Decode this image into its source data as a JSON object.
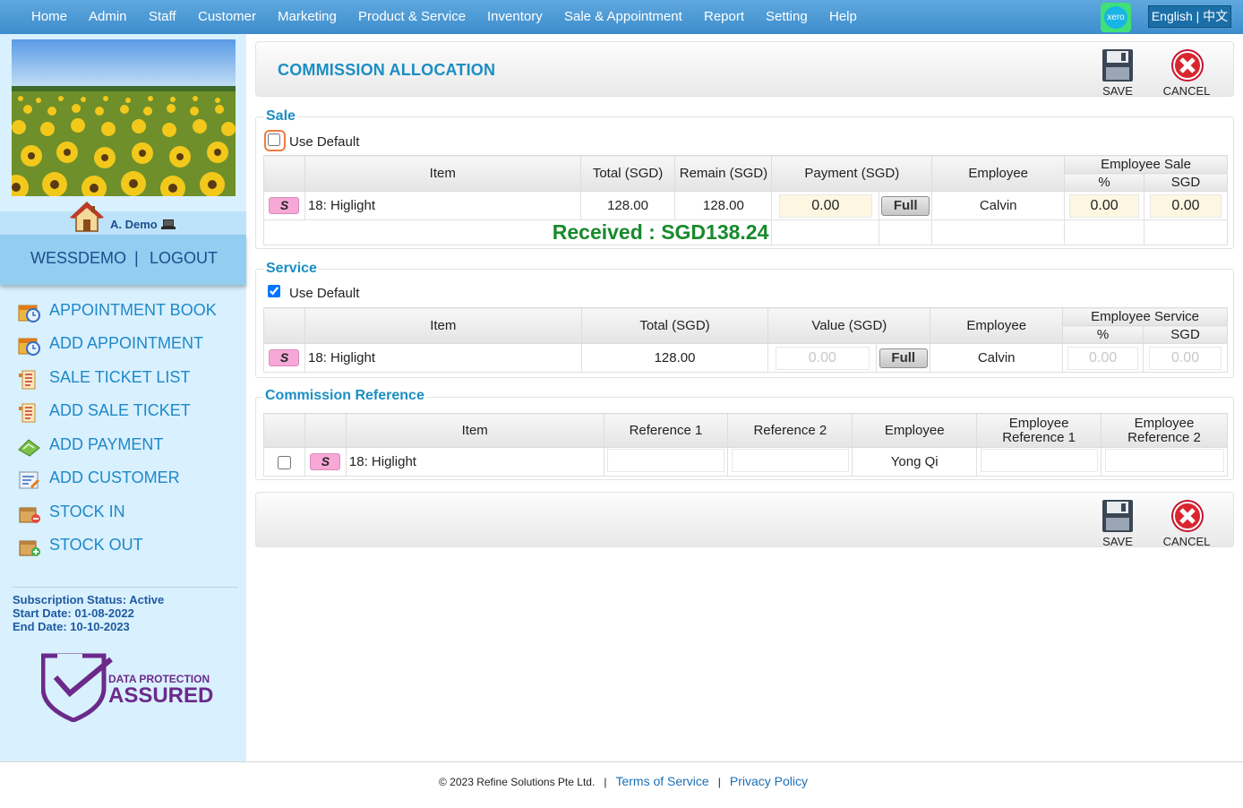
{
  "nav": {
    "items": [
      "Home",
      "Admin",
      "Staff",
      "Customer",
      "Marketing",
      "Product & Service",
      "Inventory",
      "Sale & Appointment",
      "Report",
      "Setting",
      "Help"
    ],
    "xero_label": "xero",
    "lang_english": "English",
    "lang_sep": "|",
    "lang_chinese": "中文"
  },
  "sidebar": {
    "user_name": "A. Demo",
    "company": "WESSDEMO",
    "separator": "|",
    "logout": "LOGOUT",
    "menu": [
      {
        "label": "APPOINTMENT BOOK",
        "icon": "calendar-clock-icon"
      },
      {
        "label": "ADD APPOINTMENT",
        "icon": "calendar-clock-icon"
      },
      {
        "label": "SALE TICKET LIST",
        "icon": "ticket-list-icon"
      },
      {
        "label": "ADD SALE TICKET",
        "icon": "ticket-list-icon"
      },
      {
        "label": "ADD PAYMENT",
        "icon": "payment-icon"
      },
      {
        "label": "ADD CUSTOMER",
        "icon": "add-customer-icon"
      },
      {
        "label": "STOCK IN",
        "icon": "stock-in-icon"
      },
      {
        "label": "STOCK OUT",
        "icon": "stock-out-icon"
      }
    ],
    "subscription_status": "Subscription Status: Active",
    "start_date": "Start Date: 01-08-2022",
    "end_date": "End Date: 10-10-2023",
    "dpa_top": "DATA PROTECTION",
    "dpa_bottom": "ASSURED"
  },
  "header": {
    "title": "COMMISSION ALLOCATION",
    "save_label": "SAVE",
    "cancel_label": "CANCEL"
  },
  "sale": {
    "title": "Sale",
    "use_default_label": "Use Default",
    "use_default_checked": false,
    "columns": {
      "item": "Item",
      "total": "Total (SGD)",
      "remain": "Remain (SGD)",
      "payment": "Payment (SGD)",
      "employee": "Employee",
      "emp_group": "Employee Sale",
      "pct": "%",
      "sgd": "SGD"
    },
    "row": {
      "badge": "S",
      "item": "18: Higlight",
      "total": "128.00",
      "remain": "128.00",
      "payment": "0.00",
      "full": "Full",
      "employee": "Calvin",
      "pct": "0.00",
      "sgd": "0.00"
    },
    "received": "Received : SGD138.24"
  },
  "service": {
    "title": "Service",
    "use_default_label": "Use Default",
    "use_default_checked": true,
    "columns": {
      "item": "Item",
      "total": "Total (SGD)",
      "value": "Value (SGD)",
      "employee": "Employee",
      "emp_group": "Employee Service",
      "pct": "%",
      "sgd": "SGD"
    },
    "row": {
      "badge": "S",
      "item": "18: Higlight",
      "total": "128.00",
      "value": "0.00",
      "full": "Full",
      "employee": "Calvin",
      "pct": "0.00",
      "sgd": "0.00"
    }
  },
  "reference": {
    "title": "Commission Reference",
    "columns": {
      "item": "Item",
      "ref1": "Reference 1",
      "ref2": "Reference 2",
      "employee": "Employee",
      "emp_ref1_a": "Employee",
      "emp_ref1_b": "Reference 1",
      "emp_ref2_a": "Employee",
      "emp_ref2_b": "Reference 2"
    },
    "row": {
      "badge": "S",
      "item": "18: Higlight",
      "employee": "Yong Qi"
    }
  },
  "footer": {
    "copyright": "© 2023 Refine Solutions Pte Ltd.",
    "sep": "|",
    "terms": "Terms of Service",
    "privacy": "Privacy Policy"
  }
}
